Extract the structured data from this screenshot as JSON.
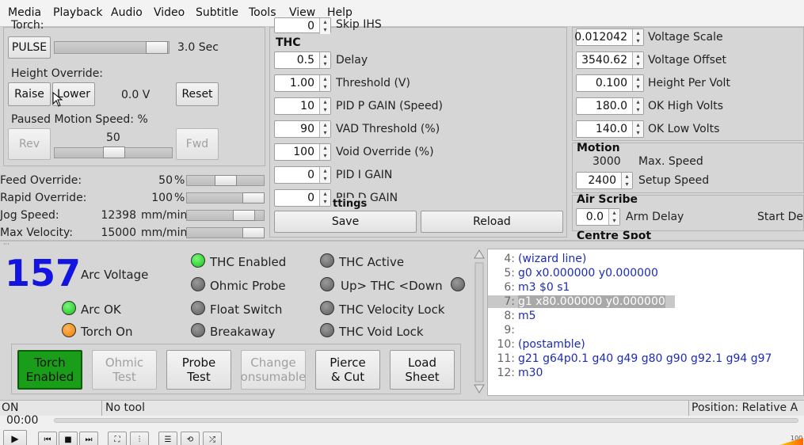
{
  "menubar": [
    "Media",
    "Playback",
    "Audio",
    "Video",
    "Subtitle",
    "Tools",
    "View",
    "Help"
  ],
  "left": {
    "torch_label": "Torch:",
    "pulse_button": "PULSE",
    "pulse_time": "3.0 Sec",
    "height_override_label": "Height Override:",
    "raise_button": "Raise",
    "lower_button": "Lower",
    "height_value": "0.0 V",
    "reset_button": "Reset",
    "paused_motion_label": "Paused Motion Speed: %",
    "rev_button": "Rev",
    "paused_speed": "50",
    "fwd_button": "Fwd",
    "overrides": [
      {
        "label": "Feed Override:",
        "value": "50",
        "unit": "%",
        "level": 0.5
      },
      {
        "label": "Rapid Override:",
        "value": "100",
        "unit": "%",
        "level": 1.0
      },
      {
        "label": "Jog Speed:",
        "value": "12398",
        "unit": "mm/min",
        "level": 0.83
      },
      {
        "label": "Max Velocity:",
        "value": "15000",
        "unit": "mm/min",
        "level": 1.0
      }
    ]
  },
  "thc": {
    "top_value": "0",
    "top_label": "Skip IHS",
    "title": "THC",
    "rows": [
      {
        "value": "0.5",
        "label": "Delay"
      },
      {
        "value": "1.00",
        "label": "Threshold (V)"
      },
      {
        "value": "10",
        "label": "PID P GAIN (Speed)"
      },
      {
        "value": "90",
        "label": "VAD Threshold (%)"
      },
      {
        "value": "100",
        "label": "Void Override (%)"
      },
      {
        "value": "0",
        "label": "PID I GAIN"
      },
      {
        "value": "0",
        "label": "PID D GAIN"
      }
    ],
    "settings_fragment": "ttings",
    "save_button": "Save",
    "reload_button": "Reload"
  },
  "right": {
    "rows": [
      {
        "value": "0.012042",
        "label": "Voltage Scale"
      },
      {
        "value": "3540.62",
        "label": "Voltage Offset"
      },
      {
        "value": "0.100",
        "label": "Height Per Volt"
      },
      {
        "value": "180.0",
        "label": "OK High Volts"
      },
      {
        "value": "140.0",
        "label": "OK Low Volts"
      }
    ],
    "motion_title": "Motion",
    "max_speed_value": "3000",
    "max_speed_label": "Max. Speed",
    "setup_speed_value": "2400",
    "setup_speed_label": "Setup Speed",
    "air_scribe_title": "Air Scribe",
    "arm_delay_value": "0.0",
    "arm_delay_label": "Arm Delay",
    "start_delay_label": "Start Dela",
    "centre_spot_title": "Centre Spot"
  },
  "status": {
    "arc_voltage_value": "157",
    "arc_voltage_label": "Arc Voltage",
    "arc_ok": "Arc OK",
    "torch_on": "Torch On",
    "thc_enabled": "THC Enabled",
    "ohmic_probe": "Ohmic Probe",
    "float_switch": "Float Switch",
    "breakaway": "Breakaway",
    "thc_active": "THC Active",
    "up_thc_down": "Up> THC <Down",
    "thc_velocity_lock": "THC Velocity Lock",
    "thc_void_lock": "THC Void Lock",
    "colors": {
      "voltage": "#1414e0",
      "led_green": "#16c016",
      "led_orange": "#f07a00",
      "torch_button": "#1a9e1a"
    }
  },
  "action_buttons": [
    {
      "line1": "Torch",
      "line2": "Enabled",
      "state": "active"
    },
    {
      "line1": "Ohmic",
      "line2": "Test",
      "state": "disabled"
    },
    {
      "line1": "Probe",
      "line2": "Test",
      "state": "normal"
    },
    {
      "line1": "Change",
      "line2": "onsumable",
      "state": "disabled"
    },
    {
      "line1": "Pierce",
      "line2": "& Cut",
      "state": "normal"
    },
    {
      "line1": "Load",
      "line2": "Sheet",
      "state": "normal"
    }
  ],
  "gcode": [
    {
      "num": "4:",
      "text": "(wizard line)"
    },
    {
      "num": "5:",
      "text": "g0 x0.000000 y0.000000"
    },
    {
      "num": "6:",
      "text": "m3 $0 s1"
    },
    {
      "num": "7:",
      "text": "g1 x80.000000 y0.000000",
      "selected": true
    },
    {
      "num": "8:",
      "text": "m5"
    },
    {
      "num": "9:",
      "text": ""
    },
    {
      "num": "10:",
      "text": "(postamble)"
    },
    {
      "num": "11:",
      "text": "g21 g64p0.1 g40 g49 g80 g90 g92.1 g94 g97"
    },
    {
      "num": "12:",
      "text": "m30"
    }
  ],
  "statusbar": {
    "state": "ON",
    "tool": "No tool",
    "position": "Position: Relative A"
  },
  "player": {
    "time": "00:00",
    "volume_text": "100"
  }
}
